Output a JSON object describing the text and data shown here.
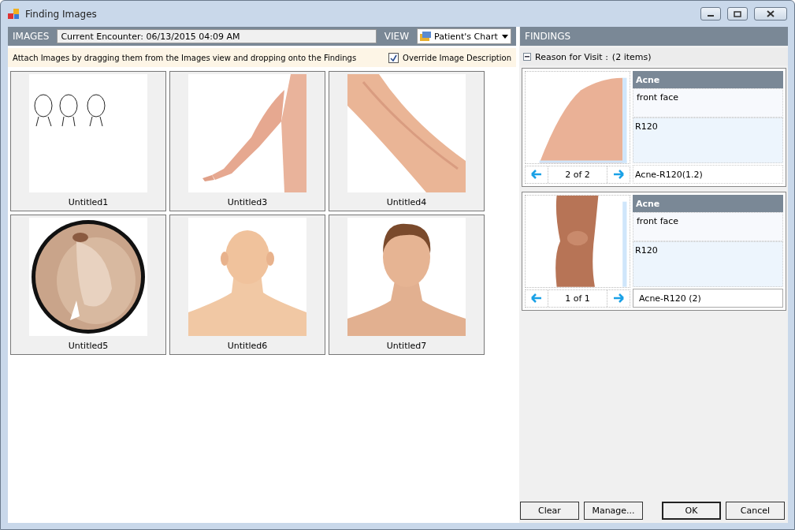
{
  "window": {
    "title": "Finding Images"
  },
  "images": {
    "header": "IMAGES",
    "encounter": "Current Encounter: 06/13/2015 04:09 AM",
    "view_label": "VIEW",
    "view": "Patient's Chart",
    "hint": "Attach Images by dragging them from the Images view and dropping onto the Findings",
    "override": {
      "label": "Override Image Description",
      "checked": true
    },
    "thumbnails": [
      {
        "name": "Untitled1",
        "kind": "picture"
      },
      {
        "name": "Untitled3",
        "kind": "picture"
      },
      {
        "name": "Untitled4",
        "kind": "picture"
      },
      {
        "name": "Untitled5",
        "kind": "picture"
      },
      {
        "name": "Untitled6",
        "kind": "picture"
      },
      {
        "name": "Untitled7",
        "kind": "picture"
      }
    ]
  },
  "findings": {
    "header": "FINDINGS",
    "group": {
      "label": "Reason for Visit :",
      "count": "(2 items)",
      "expanded": true
    },
    "cards": [
      {
        "title": "Acne",
        "description": "front face",
        "code": "R120",
        "pager": "2 of 2",
        "caption": "Acne-R120(1.2)",
        "caption_boxed": false
      },
      {
        "title": "Acne",
        "description": "front face",
        "code": "R120",
        "pager": "1 of 1",
        "caption": "Acne-R120 (2)",
        "caption_boxed": true
      }
    ]
  },
  "buttons": [
    {
      "label": "Clear",
      "default": false
    },
    {
      "label": "Manage...",
      "default": false
    },
    {
      "label": "OK",
      "default": true
    },
    {
      "label": "Cancel",
      "default": false
    }
  ]
}
